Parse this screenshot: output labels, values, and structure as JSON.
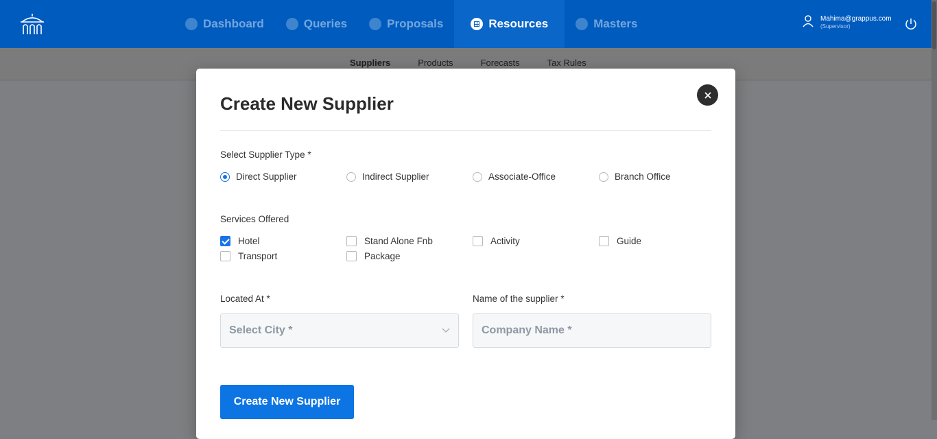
{
  "nav": {
    "items": [
      {
        "label": "Dashboard",
        "icon": "dashboard-icon",
        "active": false
      },
      {
        "label": "Queries",
        "icon": "queries-icon",
        "active": false
      },
      {
        "label": "Proposals",
        "icon": "proposals-icon",
        "active": false
      },
      {
        "label": "Resources",
        "icon": "resources-icon",
        "active": true
      },
      {
        "label": "Masters",
        "icon": "masters-icon",
        "active": false
      }
    ]
  },
  "user": {
    "email": "Mahima@grappus.com",
    "role": "(Supervisor)"
  },
  "subnav": {
    "items": [
      {
        "label": "Suppliers",
        "active": true
      },
      {
        "label": "Products",
        "active": false
      },
      {
        "label": "Forecasts",
        "active": false
      },
      {
        "label": "Tax Rules",
        "active": false
      }
    ]
  },
  "modal": {
    "title": "Create New Supplier",
    "supplier_type": {
      "label": "Select Supplier Type *",
      "options": [
        {
          "label": "Direct Supplier",
          "selected": true
        },
        {
          "label": "Indirect Supplier",
          "selected": false
        },
        {
          "label": "Associate-Office",
          "selected": false
        },
        {
          "label": "Branch Office",
          "selected": false
        }
      ]
    },
    "services": {
      "label": "Services Offered",
      "options": [
        {
          "label": "Hotel",
          "checked": true
        },
        {
          "label": "Stand Alone Fnb",
          "checked": false
        },
        {
          "label": "Activity",
          "checked": false
        },
        {
          "label": "Guide",
          "checked": false
        },
        {
          "label": "Transport",
          "checked": false
        },
        {
          "label": "Package",
          "checked": false
        }
      ]
    },
    "located_at": {
      "label": "Located At *",
      "placeholder": "Select City *"
    },
    "supplier_name": {
      "label": "Name of the supplier *",
      "placeholder": "Company Name *"
    },
    "submit_label": "Create New Supplier"
  },
  "colors": {
    "topbar": "#005bbf",
    "accent": "#1a73e8",
    "button": "#0d74e4",
    "overlay": "#7d7f82"
  }
}
